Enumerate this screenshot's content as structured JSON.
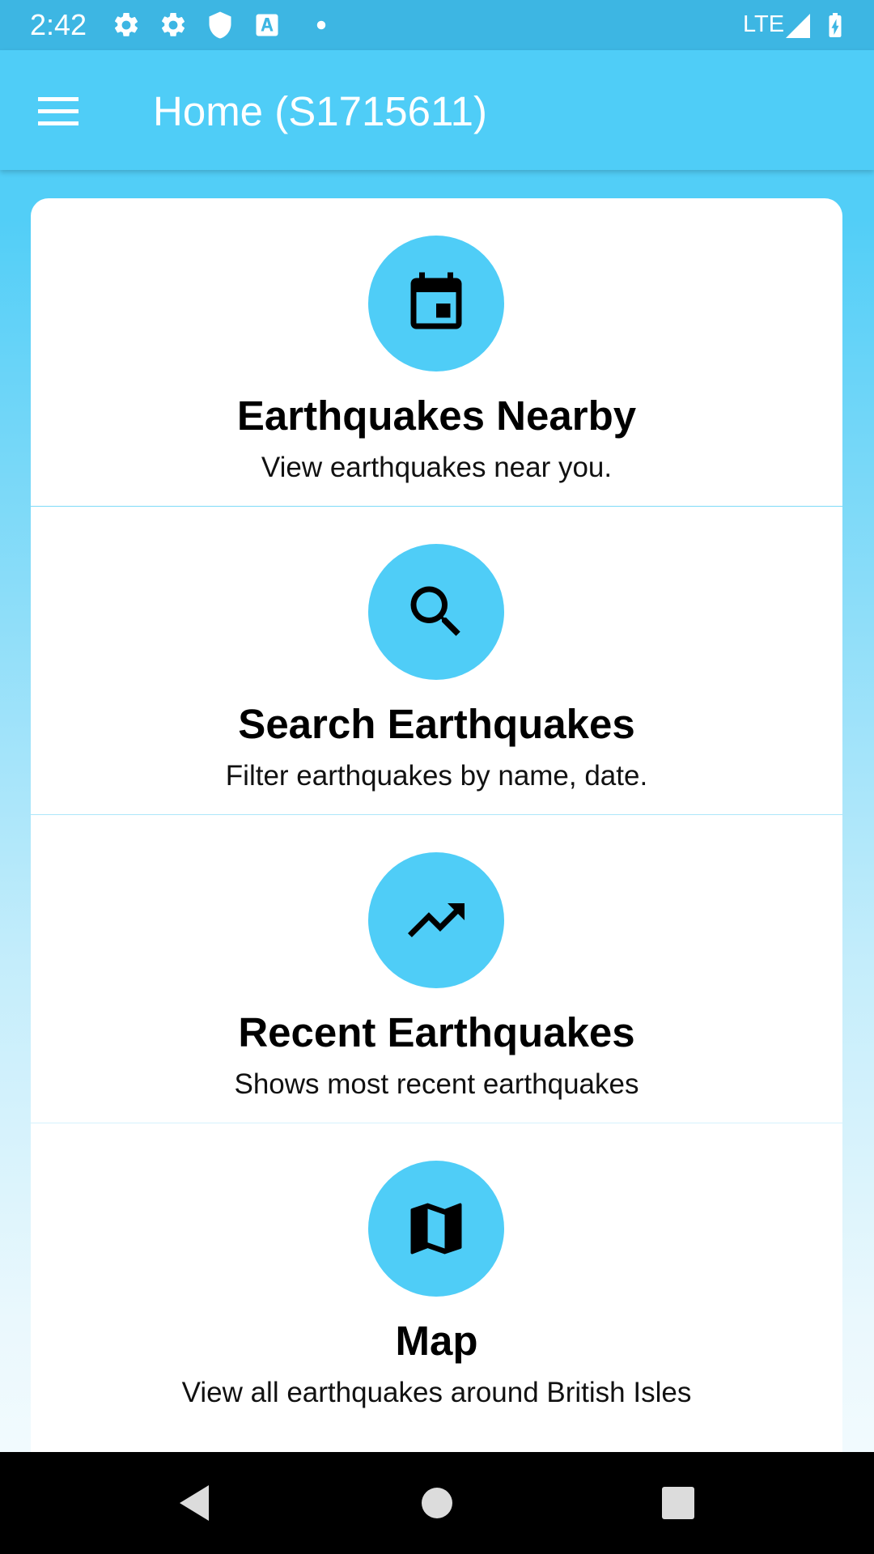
{
  "status_bar": {
    "time": "2:42",
    "network": "LTE",
    "icons": [
      "settings-icon",
      "settings-icon",
      "shield-icon",
      "text-a-icon",
      "dot-icon",
      "signal-icon",
      "battery-charging-icon"
    ]
  },
  "app_bar": {
    "title": "Home (S1715611)",
    "menu_icon": "hamburger-menu-icon"
  },
  "cards": [
    {
      "title": "Earthquakes Nearby",
      "description": "View earthquakes near you.",
      "icon": "calendar-icon"
    },
    {
      "title": "Search Earthquakes",
      "description": "Filter earthquakes by name, date.",
      "icon": "search-icon"
    },
    {
      "title": "Recent Earthquakes",
      "description": "Shows most recent earthquakes",
      "icon": "trending-up-icon"
    },
    {
      "title": "Map",
      "description": "View all earthquakes around British Isles",
      "icon": "map-icon"
    }
  ],
  "nav_bar": {
    "buttons": [
      "back-icon",
      "home-icon",
      "recents-icon"
    ]
  },
  "colors": {
    "accent": "#4fcdf7",
    "status_bar": "#3db6e3",
    "card_background": "#ffffff",
    "nav_bar": "#000000"
  }
}
